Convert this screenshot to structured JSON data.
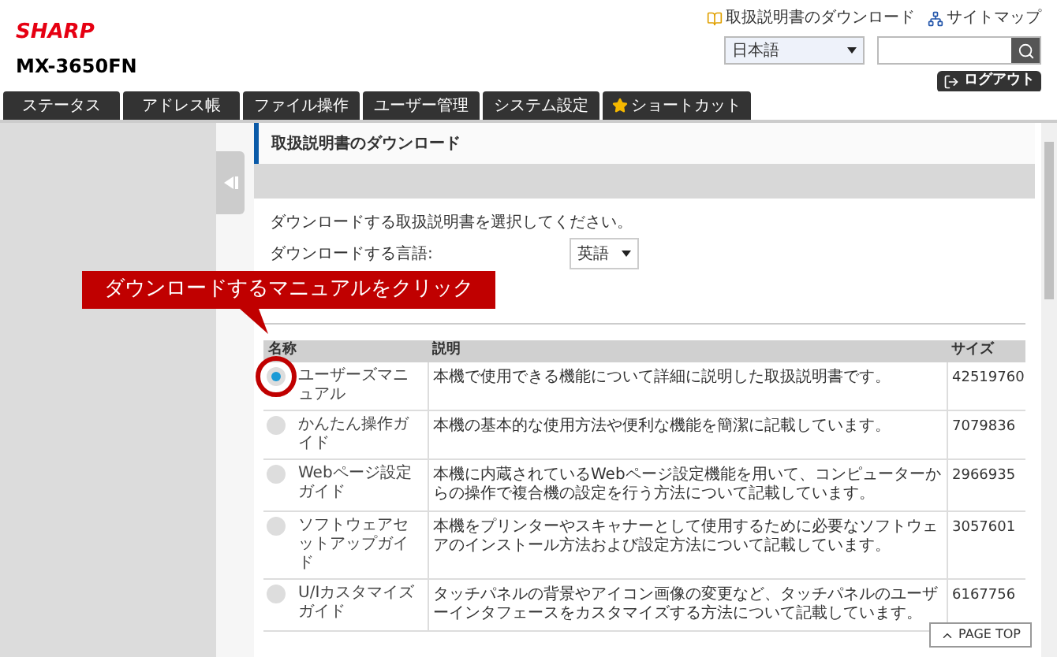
{
  "header": {
    "logo": "SHARP",
    "model": "MX-3650FN",
    "links": [
      "取扱説明書のダウンロード",
      "サイトマップ"
    ],
    "language": "日本語",
    "logout": "ログアウト"
  },
  "tabs": [
    {
      "label": "ステータス",
      "selected": false
    },
    {
      "label": "アドレス帳",
      "selected": false
    },
    {
      "label": "ファイル操作",
      "selected": false
    },
    {
      "label": "ユーザー管理",
      "selected": false
    },
    {
      "label": "システム設定",
      "selected": false
    },
    {
      "label": "ショートカット",
      "selected": false,
      "kind": "star"
    }
  ],
  "page": {
    "title": "取扱説明書のダウンロード",
    "instruction": "ダウンロードする取扱説明書を選択してください。",
    "language_label": "ダウンロードする言語:",
    "language_value": "英語"
  },
  "callout": "ダウンロードするマニュアルをクリック",
  "table": {
    "columns": [
      "名称",
      "説明",
      "サイズ"
    ],
    "rows": [
      {
        "name": "ユーザーズマニュアル",
        "description": "本機で使用できる機能について詳細に説明した取扱説明書です。",
        "size": "42519760",
        "selected": true
      },
      {
        "name": "かんたん操作ガイド",
        "description": "本機の基本的な使用方法や便利な機能を簡潔に記載しています。",
        "size": "7079836",
        "selected": false
      },
      {
        "name": "Webページ設定ガイド",
        "description": "本機に内蔵されているWebページ設定機能を用いて、コンピューターからの操作で複合機の設定を行う方法について記載しています。",
        "size": "2966935",
        "selected": false
      },
      {
        "name": "ソフトウェアセットアップガイド",
        "description": "本機をプリンターやスキャナーとして使用するために必要なソフトウェアのインストール方法および設定方法について記載しています。",
        "size": "3057601",
        "selected": false
      },
      {
        "name": "U/Iカスタマイズガイド",
        "description": "タッチパネルの背景やアイコン画像の変更など、タッチパネルのユーザーインタフェースをカスタマイズする方法について記載しています。",
        "size": "6167756",
        "selected": false
      }
    ]
  },
  "page_top": "PAGE TOP"
}
